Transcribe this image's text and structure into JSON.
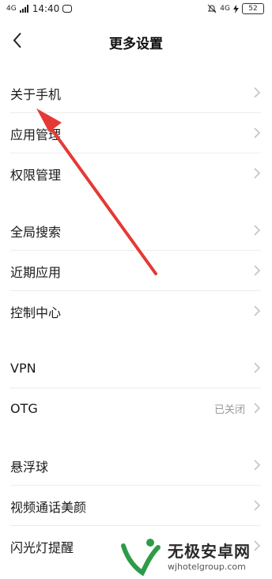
{
  "status_bar": {
    "network": "4G",
    "time": "14:40",
    "right_network": "4G",
    "battery": "52"
  },
  "header": {
    "title": "更多设置"
  },
  "groups": [
    {
      "items": [
        {
          "label": "关于手机"
        },
        {
          "label": "应用管理"
        },
        {
          "label": "权限管理"
        }
      ]
    },
    {
      "items": [
        {
          "label": "全局搜索"
        },
        {
          "label": "近期应用"
        },
        {
          "label": "控制中心"
        }
      ]
    },
    {
      "items": [
        {
          "label": "VPN"
        },
        {
          "label": "OTG",
          "value": "已关闭"
        }
      ]
    },
    {
      "items": [
        {
          "label": "悬浮球"
        },
        {
          "label": "视频通话美颜"
        },
        {
          "label": "闪光灯提醒"
        }
      ]
    }
  ],
  "watermark": {
    "title": "无极安卓网",
    "url": "wjhotelgroup.com"
  },
  "colors": {
    "accent_red": "#e53935",
    "chevron": "#c4c4c4",
    "secondary_text": "#9a9a9a"
  }
}
